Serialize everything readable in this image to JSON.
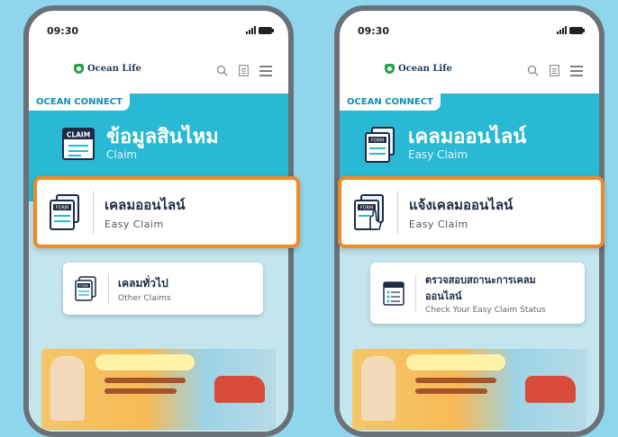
{
  "colors": {
    "background": "#8fd6ec",
    "banner": "#29b9d4",
    "highlight": "#f08a24",
    "phone_frame": "#6b7178"
  },
  "left_phone": {
    "time": "09:30",
    "logo": "Ocean Life",
    "section_label": "OCEAN CONNECT",
    "banner_title": "ข้อมูลสินไหม",
    "banner_subtitle": "Claim",
    "highlight_card": {
      "title": "เคลมออนไลน์",
      "subtitle": "Easy Claim"
    },
    "secondary_card": {
      "title": "เคลมทั่วไป",
      "subtitle": "Other Claims"
    }
  },
  "right_phone": {
    "time": "09:30",
    "logo": "Ocean Life",
    "section_label": "OCEAN CONNECT",
    "banner_title": "เคลมออนไลน์",
    "banner_subtitle": "Easy Claim",
    "highlight_card": {
      "title": "แจ้งเคลมออนไลน์",
      "subtitle": "Easy Claim"
    },
    "secondary_card": {
      "title_line1": "ตรวจสอบสถานะการเคลม",
      "title_line2": "ออนไลน์",
      "subtitle": "Check Your Easy Claim Status"
    }
  },
  "icons": {
    "logo": "shield-logo-icon",
    "search": "search-icon",
    "document": "document-icon",
    "menu": "hamburger-menu-icon",
    "claim_banner": "claim-card-icon",
    "form": "form-document-icon",
    "form_hand": "form-hand-icon",
    "status": "clipboard-status-icon",
    "promo": "promo-banner-image"
  }
}
